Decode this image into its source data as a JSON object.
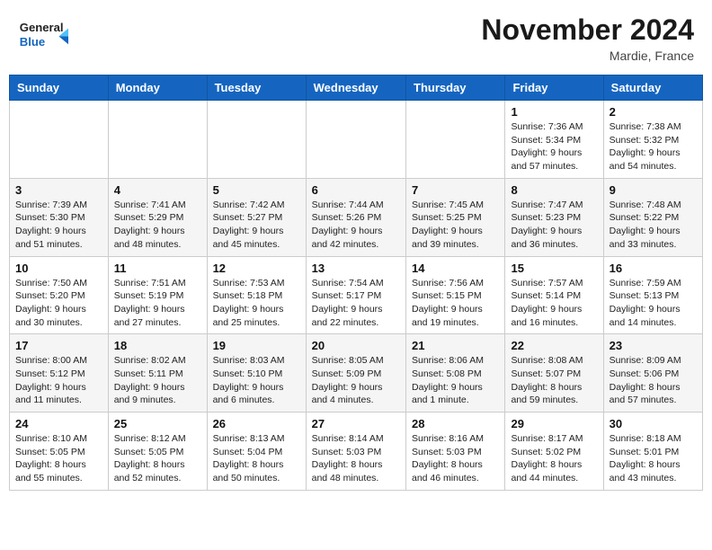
{
  "header": {
    "logo_line1": "General",
    "logo_line2": "Blue",
    "month": "November 2024",
    "location": "Mardie, France"
  },
  "days_of_week": [
    "Sunday",
    "Monday",
    "Tuesday",
    "Wednesday",
    "Thursday",
    "Friday",
    "Saturday"
  ],
  "weeks": [
    [
      {
        "day": "",
        "info": ""
      },
      {
        "day": "",
        "info": ""
      },
      {
        "day": "",
        "info": ""
      },
      {
        "day": "",
        "info": ""
      },
      {
        "day": "",
        "info": ""
      },
      {
        "day": "1",
        "info": "Sunrise: 7:36 AM\nSunset: 5:34 PM\nDaylight: 9 hours\nand 57 minutes."
      },
      {
        "day": "2",
        "info": "Sunrise: 7:38 AM\nSunset: 5:32 PM\nDaylight: 9 hours\nand 54 minutes."
      }
    ],
    [
      {
        "day": "3",
        "info": "Sunrise: 7:39 AM\nSunset: 5:30 PM\nDaylight: 9 hours\nand 51 minutes."
      },
      {
        "day": "4",
        "info": "Sunrise: 7:41 AM\nSunset: 5:29 PM\nDaylight: 9 hours\nand 48 minutes."
      },
      {
        "day": "5",
        "info": "Sunrise: 7:42 AM\nSunset: 5:27 PM\nDaylight: 9 hours\nand 45 minutes."
      },
      {
        "day": "6",
        "info": "Sunrise: 7:44 AM\nSunset: 5:26 PM\nDaylight: 9 hours\nand 42 minutes."
      },
      {
        "day": "7",
        "info": "Sunrise: 7:45 AM\nSunset: 5:25 PM\nDaylight: 9 hours\nand 39 minutes."
      },
      {
        "day": "8",
        "info": "Sunrise: 7:47 AM\nSunset: 5:23 PM\nDaylight: 9 hours\nand 36 minutes."
      },
      {
        "day": "9",
        "info": "Sunrise: 7:48 AM\nSunset: 5:22 PM\nDaylight: 9 hours\nand 33 minutes."
      }
    ],
    [
      {
        "day": "10",
        "info": "Sunrise: 7:50 AM\nSunset: 5:20 PM\nDaylight: 9 hours\nand 30 minutes."
      },
      {
        "day": "11",
        "info": "Sunrise: 7:51 AM\nSunset: 5:19 PM\nDaylight: 9 hours\nand 27 minutes."
      },
      {
        "day": "12",
        "info": "Sunrise: 7:53 AM\nSunset: 5:18 PM\nDaylight: 9 hours\nand 25 minutes."
      },
      {
        "day": "13",
        "info": "Sunrise: 7:54 AM\nSunset: 5:17 PM\nDaylight: 9 hours\nand 22 minutes."
      },
      {
        "day": "14",
        "info": "Sunrise: 7:56 AM\nSunset: 5:15 PM\nDaylight: 9 hours\nand 19 minutes."
      },
      {
        "day": "15",
        "info": "Sunrise: 7:57 AM\nSunset: 5:14 PM\nDaylight: 9 hours\nand 16 minutes."
      },
      {
        "day": "16",
        "info": "Sunrise: 7:59 AM\nSunset: 5:13 PM\nDaylight: 9 hours\nand 14 minutes."
      }
    ],
    [
      {
        "day": "17",
        "info": "Sunrise: 8:00 AM\nSunset: 5:12 PM\nDaylight: 9 hours\nand 11 minutes."
      },
      {
        "day": "18",
        "info": "Sunrise: 8:02 AM\nSunset: 5:11 PM\nDaylight: 9 hours\nand 9 minutes."
      },
      {
        "day": "19",
        "info": "Sunrise: 8:03 AM\nSunset: 5:10 PM\nDaylight: 9 hours\nand 6 minutes."
      },
      {
        "day": "20",
        "info": "Sunrise: 8:05 AM\nSunset: 5:09 PM\nDaylight: 9 hours\nand 4 minutes."
      },
      {
        "day": "21",
        "info": "Sunrise: 8:06 AM\nSunset: 5:08 PM\nDaylight: 9 hours\nand 1 minute."
      },
      {
        "day": "22",
        "info": "Sunrise: 8:08 AM\nSunset: 5:07 PM\nDaylight: 8 hours\nand 59 minutes."
      },
      {
        "day": "23",
        "info": "Sunrise: 8:09 AM\nSunset: 5:06 PM\nDaylight: 8 hours\nand 57 minutes."
      }
    ],
    [
      {
        "day": "24",
        "info": "Sunrise: 8:10 AM\nSunset: 5:05 PM\nDaylight: 8 hours\nand 55 minutes."
      },
      {
        "day": "25",
        "info": "Sunrise: 8:12 AM\nSunset: 5:05 PM\nDaylight: 8 hours\nand 52 minutes."
      },
      {
        "day": "26",
        "info": "Sunrise: 8:13 AM\nSunset: 5:04 PM\nDaylight: 8 hours\nand 50 minutes."
      },
      {
        "day": "27",
        "info": "Sunrise: 8:14 AM\nSunset: 5:03 PM\nDaylight: 8 hours\nand 48 minutes."
      },
      {
        "day": "28",
        "info": "Sunrise: 8:16 AM\nSunset: 5:03 PM\nDaylight: 8 hours\nand 46 minutes."
      },
      {
        "day": "29",
        "info": "Sunrise: 8:17 AM\nSunset: 5:02 PM\nDaylight: 8 hours\nand 44 minutes."
      },
      {
        "day": "30",
        "info": "Sunrise: 8:18 AM\nSunset: 5:01 PM\nDaylight: 8 hours\nand 43 minutes."
      }
    ]
  ]
}
